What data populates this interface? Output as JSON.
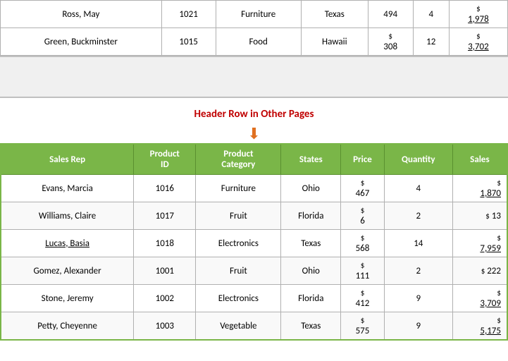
{
  "topSection": {
    "rows": [
      {
        "salesRep": "Ross, May",
        "productId": "1021",
        "productCategory": "Furniture",
        "state": "Texas",
        "price": "494",
        "quantity": "4",
        "sales": "1,978",
        "salesUnderline": true,
        "pricePrefix": "",
        "salesPrefix": "$"
      },
      {
        "salesRep": "Green, Buckminster",
        "productId": "1015",
        "productCategory": "Food",
        "state": "Hawaii",
        "price": "308",
        "pricePrefix": "$",
        "quantity": "12",
        "sales": "3,702",
        "salesUnderline": true,
        "salesPrefix": "$"
      }
    ]
  },
  "headerLabel": "Header Row in Other Pages",
  "mainTable": {
    "headers": [
      "Sales Rep",
      "Product ID",
      "Product Category",
      "States",
      "Price",
      "Quantity",
      "Sales"
    ],
    "rows": [
      {
        "salesRep": "Evans, Marcia",
        "productId": "1016",
        "productCategory": "Furniture",
        "state": "Ohio",
        "price": "467",
        "pricePrefix": "$",
        "quantity": "4",
        "sales": "1,870",
        "salesPrefix": "$",
        "salesUnderline": true
      },
      {
        "salesRep": "Williams, Claire",
        "productId": "1017",
        "productCategory": "Fruit",
        "state": "Florida",
        "price": "6",
        "pricePrefix": "$",
        "quantity": "2",
        "sales": "13",
        "salesPrefix": "$",
        "salesUnderline": false
      },
      {
        "salesRep": "Lucas, Basia",
        "productId": "1018",
        "productCategory": "Electronics",
        "state": "Texas",
        "price": "568",
        "pricePrefix": "$",
        "quantity": "14",
        "sales": "7,959",
        "salesPrefix": "$",
        "salesUnderline": true
      },
      {
        "salesRep": "Gomez, Alexander",
        "productId": "1001",
        "productCategory": "Fruit",
        "state": "Ohio",
        "price": "111",
        "pricePrefix": "$",
        "quantity": "2",
        "sales": "222",
        "salesPrefix": "$",
        "salesUnderline": false
      },
      {
        "salesRep": "Stone, Jeremy",
        "productId": "1002",
        "productCategory": "Electronics",
        "state": "Florida",
        "price": "412",
        "pricePrefix": "$",
        "quantity": "9",
        "sales": "3,709",
        "salesPrefix": "$",
        "salesUnderline": true
      },
      {
        "salesRep": "Petty, Cheyenne",
        "productId": "1003",
        "productCategory": "Vegetable",
        "state": "Texas",
        "price": "575",
        "pricePrefix": "$",
        "quantity": "9",
        "sales": "5,175",
        "salesPrefix": "$",
        "salesUnderline": true
      }
    ]
  }
}
